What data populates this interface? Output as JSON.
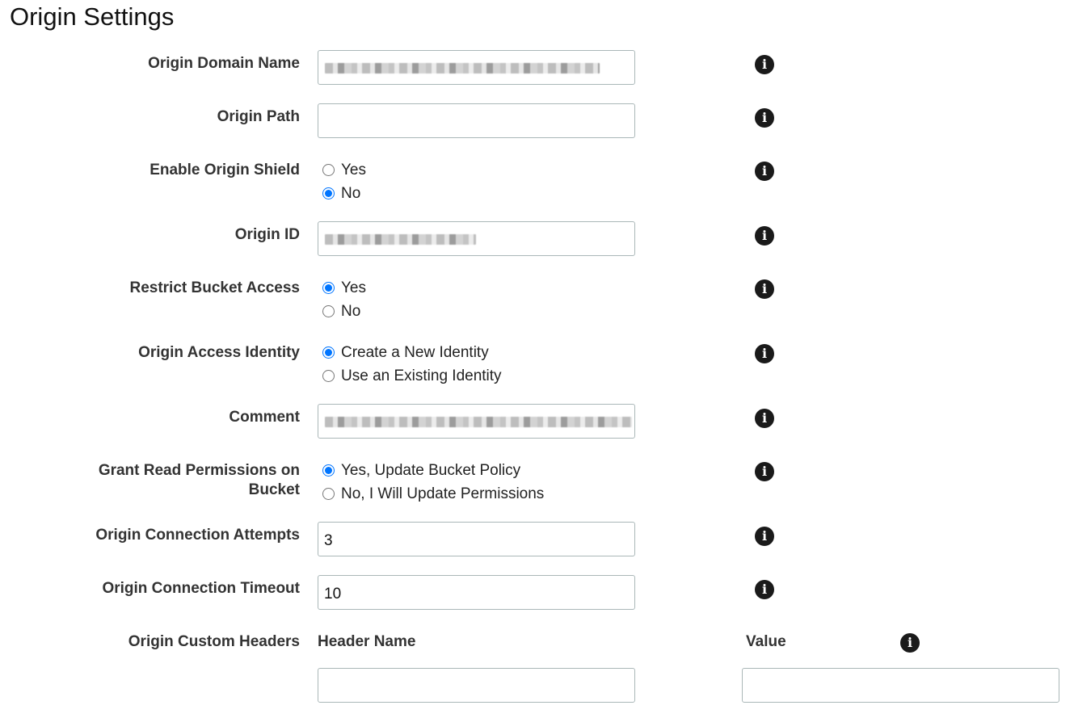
{
  "title": "Origin Settings",
  "fields": {
    "origin_domain_name": {
      "label": "Origin Domain Name"
    },
    "origin_path": {
      "label": "Origin Path",
      "value": ""
    },
    "origin_shield": {
      "label": "Enable Origin Shield",
      "options": [
        "Yes",
        "No"
      ],
      "selected": "No"
    },
    "origin_id": {
      "label": "Origin ID"
    },
    "restrict_bucket": {
      "label": "Restrict Bucket Access",
      "options": [
        "Yes",
        "No"
      ],
      "selected": "Yes"
    },
    "origin_access_identity": {
      "label": "Origin Access Identity",
      "options": [
        "Create a New Identity",
        "Use an Existing Identity"
      ],
      "selected": "Create a New Identity"
    },
    "comment": {
      "label": "Comment"
    },
    "grant_read": {
      "label_line1": "Grant Read Permissions on",
      "label_line2": "Bucket",
      "options": [
        "Yes, Update Bucket Policy",
        "No, I Will Update Permissions"
      ],
      "selected": "Yes, Update Bucket Policy"
    },
    "connection_attempts": {
      "label": "Origin Connection Attempts",
      "value": "3"
    },
    "connection_timeout": {
      "label": "Origin Connection Timeout",
      "value": "10"
    },
    "custom_headers": {
      "label": "Origin Custom Headers",
      "header_name_label": "Header Name",
      "value_label": "Value",
      "header_name": "",
      "header_value": ""
    }
  },
  "icons": {
    "info": "info-icon"
  },
  "colors": {
    "radio_selected": "#0075ff",
    "input_border": "#aab7b8"
  }
}
